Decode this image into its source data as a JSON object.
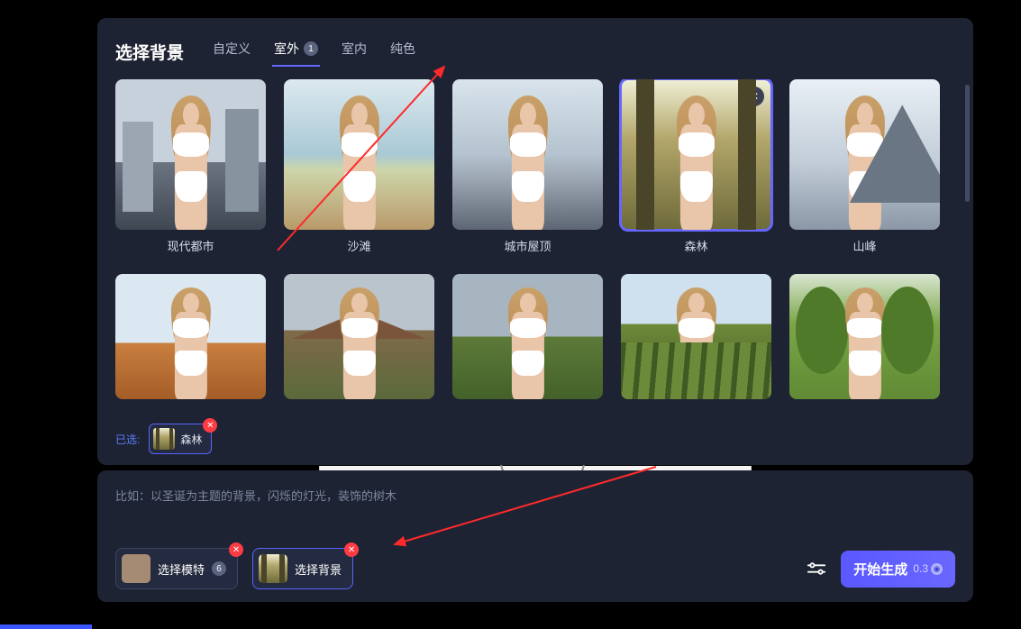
{
  "header": {
    "title": "选择背景",
    "tabs": [
      {
        "label": "自定义",
        "active": false
      },
      {
        "label": "室外",
        "active": true,
        "badge": "1"
      },
      {
        "label": "室内",
        "active": false
      },
      {
        "label": "纯色",
        "active": false
      }
    ]
  },
  "backgrounds": [
    {
      "id": "city",
      "label": "现代都市",
      "theme": "bg-city",
      "selected": false
    },
    {
      "id": "beach",
      "label": "沙滩",
      "theme": "bg-beach",
      "selected": false
    },
    {
      "id": "roof",
      "label": "城市屋顶",
      "theme": "bg-roof",
      "selected": false
    },
    {
      "id": "forest",
      "label": "森林",
      "theme": "bg-forest",
      "selected": true
    },
    {
      "id": "peak",
      "label": "山峰",
      "theme": "bg-peak",
      "selected": false
    },
    {
      "id": "desert",
      "label": "",
      "theme": "bg-desert",
      "selected": false
    },
    {
      "id": "farm",
      "label": "",
      "theme": "bg-farm",
      "selected": false
    },
    {
      "id": "grass",
      "label": "",
      "theme": "bg-grass",
      "selected": false
    },
    {
      "id": "vine",
      "label": "",
      "theme": "bg-vine",
      "selected": false
    },
    {
      "id": "trees",
      "label": "",
      "theme": "bg-trees",
      "selected": false
    }
  ],
  "selected": {
    "prefix": "已选:",
    "label": "森林",
    "theme": "bg-forest"
  },
  "prompt_hint": "比如：以圣诞为主题的背景，闪烁的灯光，装饰的树木",
  "bottom": {
    "model": {
      "label": "选择模特",
      "badge": "6"
    },
    "background": {
      "label": "选择背景",
      "theme": "bg-forest"
    },
    "start": {
      "label": "开始生成",
      "cost": "0.3"
    }
  }
}
